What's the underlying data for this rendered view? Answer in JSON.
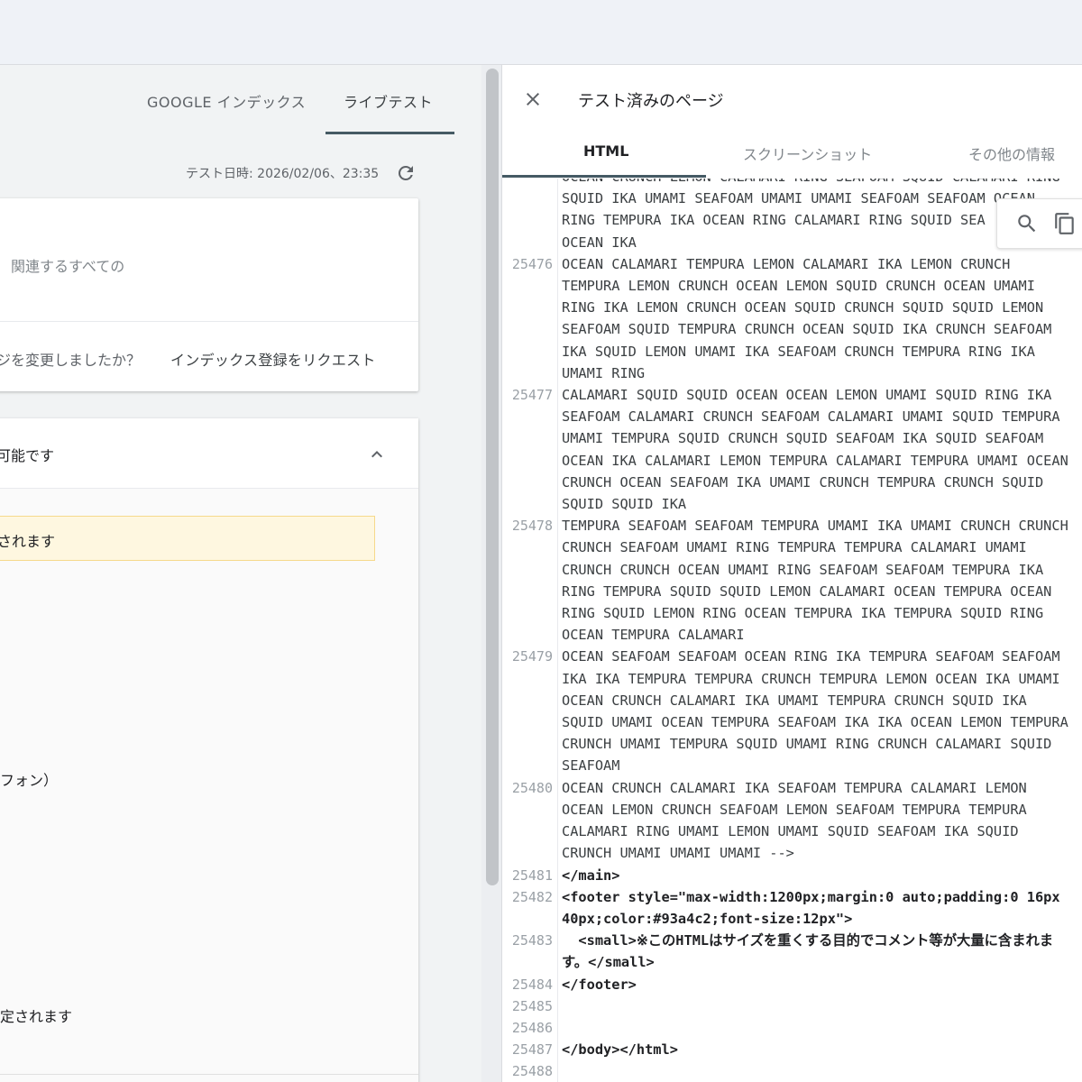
{
  "left": {
    "tabs": [
      {
        "label": "GOOGLE インデックス"
      },
      {
        "label": "ライブテスト"
      }
    ],
    "test_date": "テスト日時: 2026/02/06、23:35",
    "card1": {
      "related": "関連するすべての",
      "changed_question": "ジを変更しましたか？",
      "request_button": "インデックス登録をリクエスト"
    },
    "card2": {
      "title": "可能です",
      "warning": "されます",
      "phone": "フォン）",
      "set": "定されます"
    }
  },
  "right": {
    "title": "テスト済みのページ",
    "tabs": [
      {
        "label": "HTML"
      },
      {
        "label": "スクリーンショット"
      },
      {
        "label": "その他の情報"
      }
    ],
    "code_lines": [
      {
        "num": "",
        "text": "OCEAN CRUNCH LEMON CALAMARI RING SEAFOAM SQUID CALAMARI RING"
      },
      {
        "num": "",
        "text": "SQUID IKA UMAMI SEAFOAM UMAMI UMAMI SEAFOAM SEAFOAM OCEAN"
      },
      {
        "num": "",
        "text": "RING TEMPURA IKA OCEAN RING CALAMARI RING SQUID SEA"
      },
      {
        "num": "",
        "text": "OCEAN IKA"
      },
      {
        "num": "25476",
        "text": "OCEAN CALAMARI TEMPURA LEMON CALAMARI IKA LEMON CRUNCH"
      },
      {
        "num": "",
        "text": "TEMPURA LEMON CRUNCH OCEAN LEMON SQUID CRUNCH OCEAN UMAMI"
      },
      {
        "num": "",
        "text": "RING IKA LEMON CRUNCH OCEAN SQUID CRUNCH SQUID SQUID LEMON"
      },
      {
        "num": "",
        "text": "SEAFOAM SQUID TEMPURA CRUNCH OCEAN SQUID IKA CRUNCH SEAFOAM"
      },
      {
        "num": "",
        "text": "IKA SQUID LEMON UMAMI IKA SEAFOAM CRUNCH TEMPURA RING IKA"
      },
      {
        "num": "",
        "text": "UMAMI RING"
      },
      {
        "num": "25477",
        "text": "CALAMARI SQUID SQUID OCEAN OCEAN LEMON UMAMI SQUID RING IKA"
      },
      {
        "num": "",
        "text": "SEAFOAM CALAMARI CRUNCH SEAFOAM CALAMARI UMAMI SQUID TEMPURA"
      },
      {
        "num": "",
        "text": "UMAMI TEMPURA SQUID CRUNCH SQUID SEAFOAM IKA SQUID SEAFOAM"
      },
      {
        "num": "",
        "text": "OCEAN IKA CALAMARI LEMON TEMPURA CALAMARI TEMPURA UMAMI OCEAN"
      },
      {
        "num": "",
        "text": "CRUNCH OCEAN SEAFOAM IKA UMAMI CRUNCH TEMPURA CRUNCH SQUID"
      },
      {
        "num": "",
        "text": "SQUID SQUID IKA"
      },
      {
        "num": "25478",
        "text": "TEMPURA SEAFOAM SEAFOAM TEMPURA UMAMI IKA UMAMI CRUNCH CRUNCH"
      },
      {
        "num": "",
        "text": "CRUNCH SEAFOAM UMAMI RING TEMPURA TEMPURA CALAMARI UMAMI"
      },
      {
        "num": "",
        "text": "CRUNCH CRUNCH OCEAN UMAMI RING SEAFOAM SEAFOAM TEMPURA IKA"
      },
      {
        "num": "",
        "text": "RING TEMPURA SQUID SQUID LEMON CALAMARI OCEAN TEMPURA OCEAN"
      },
      {
        "num": "",
        "text": "RING SQUID LEMON RING OCEAN TEMPURA IKA TEMPURA SQUID RING"
      },
      {
        "num": "",
        "text": "OCEAN TEMPURA CALAMARI"
      },
      {
        "num": "25479",
        "text": "OCEAN SEAFOAM SEAFOAM OCEAN RING IKA TEMPURA SEAFOAM SEAFOAM"
      },
      {
        "num": "",
        "text": "IKA IKA TEMPURA TEMPURA CRUNCH TEMPURA LEMON OCEAN IKA UMAMI"
      },
      {
        "num": "",
        "text": "OCEAN CRUNCH CALAMARI IKA UMAMI TEMPURA CRUNCH SQUID IKA"
      },
      {
        "num": "",
        "text": "SQUID UMAMI OCEAN TEMPURA SEAFOAM IKA IKA OCEAN LEMON TEMPURA"
      },
      {
        "num": "",
        "text": "CRUNCH UMAMI TEMPURA SQUID UMAMI RING CRUNCH CALAMARI SQUID"
      },
      {
        "num": "",
        "text": "SEAFOAM"
      },
      {
        "num": "25480",
        "text": "OCEAN CRUNCH CALAMARI IKA SEAFOAM TEMPURA CALAMARI LEMON"
      },
      {
        "num": "",
        "text": "OCEAN LEMON CRUNCH SEAFOAM LEMON SEAFOAM TEMPURA TEMPURA"
      },
      {
        "num": "",
        "text": "CALAMARI RING UMAMI LEMON UMAMI SQUID SEAFOAM IKA SQUID"
      },
      {
        "num": "",
        "text": "CRUNCH UMAMI UMAMI UMAMI -->"
      },
      {
        "num": "25481",
        "text": "</main>",
        "tag": true
      },
      {
        "num": "25482",
        "text": "<footer style=\"max-width:1200px;margin:0 auto;padding:0 16px",
        "tag": true
      },
      {
        "num": "",
        "text": "40px;color:#93a4c2;font-size:12px\">",
        "tag": true
      },
      {
        "num": "25483",
        "text": "  <small>※このHTMLはサイズを重くする目的でコメント等が大量に含まれま",
        "tag": true
      },
      {
        "num": "",
        "text": "す。</small>",
        "tag": true
      },
      {
        "num": "25484",
        "text": "</footer>",
        "tag": true
      },
      {
        "num": "25485",
        "text": ""
      },
      {
        "num": "25486",
        "text": ""
      },
      {
        "num": "25487",
        "text": "</body></html>",
        "tag": true
      },
      {
        "num": "25488",
        "text": ""
      }
    ]
  },
  "icons": {
    "refresh": "refresh-icon",
    "close": "close-icon",
    "search": "search-icon",
    "copy": "copy-icon",
    "chevron": "chevron-up-icon"
  },
  "colors": {
    "tab_underline": "#455a64",
    "warning_bg": "#fef7e0"
  }
}
